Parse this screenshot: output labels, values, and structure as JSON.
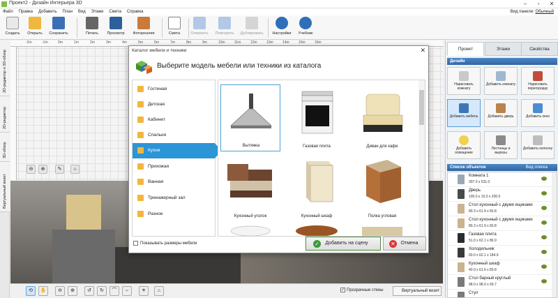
{
  "window": {
    "title": "Проект2 - Дизайн Интерьера 3D",
    "panel_view_label": "Вид панели:",
    "panel_view_value": "Обычный"
  },
  "menu": [
    "Файл",
    "Правка",
    "Добавить",
    "План",
    "Вид",
    "Этажи",
    "Смета",
    "Справка"
  ],
  "toolbar": {
    "create": "Создать",
    "open": "Открыть",
    "save": "Сохранить",
    "print": "Печать",
    "preview": "Просмотр",
    "photo": "Фотореалия",
    "estimate": "Смета",
    "undo": "Отменить",
    "redo": "Повторить",
    "duplicate": "Дублировать",
    "settings": "Настройки",
    "tutorial": "Учебник"
  },
  "side_tabs": [
    "2D-редактор и 3D-обзор",
    "2D-редактор",
    "3D-обзор",
    "Виртуальный визит"
  ],
  "ruler": [
    "-2m",
    "-1m",
    "0m",
    "1m",
    "2m",
    "3m",
    "4m",
    "5m",
    "6m",
    "7m",
    "8m",
    "9m",
    "10m",
    "11m",
    "12m",
    "13m",
    "14m",
    "15m",
    "16m"
  ],
  "bottom": {
    "transparent_walls": "Прозрачные стены",
    "virtual_visit": "Виртуальный визит"
  },
  "right_panel": {
    "tabs": [
      "Проект",
      "Этажи",
      "Свойства"
    ],
    "design_header": "Дизайн",
    "design_buttons": [
      "Нарисовать комнату",
      "Добавить комнату",
      "Нарисовать перегородку",
      "Добавить мебель",
      "Добавить дверь",
      "Добавить окно",
      "Добавить освещение",
      "Лестницы и вырезы",
      "Добавить колонну"
    ],
    "objects_header": "Список объектов",
    "view_list": "Вид списка",
    "objects": [
      {
        "name": "Комната 1",
        "size": "307.0 x 531.0"
      },
      {
        "name": "Дверь",
        "size": "100.0 x 15.0 x 200.0"
      },
      {
        "name": "Стол кухонный с двумя ящиками",
        "size": "80.3 x 61.9 x 83.8"
      },
      {
        "name": "Стол кухонный с двумя ящиками",
        "size": "80.3 x 61.9 x 83.8"
      },
      {
        "name": "Газовая плита",
        "size": "51.0 x 62.1 x 86.9"
      },
      {
        "name": "Холодильник",
        "size": "60.0 x 62.1 x 184.9"
      },
      {
        "name": "Кухонный шкаф",
        "size": "40.0 x 61.6 x 83.8"
      },
      {
        "name": "Стол барный круглый",
        "size": "98.0 x 98.0 x 69.7"
      },
      {
        "name": "Стул",
        "size": ""
      }
    ]
  },
  "dialog": {
    "title": "Каталог мебели и техники",
    "heading": "Выберите модель мебели или техники из каталога",
    "categories": [
      "Гостиная",
      "Детская",
      "Кабинет",
      "Спальня",
      "Кухня",
      "Прихожая",
      "Ванная",
      "Тренажерный зал",
      "Разное"
    ],
    "active_category": "Кухня",
    "items": [
      "Вытяжка",
      "Газовая плита",
      "Диван для кафе",
      "Кухонный уголок",
      "Кухонный шкаф",
      "Полка угловая"
    ],
    "show_sizes": "Показывать размеры мебели",
    "add_button": "Добавить на сцену",
    "cancel_button": "Отмена"
  }
}
